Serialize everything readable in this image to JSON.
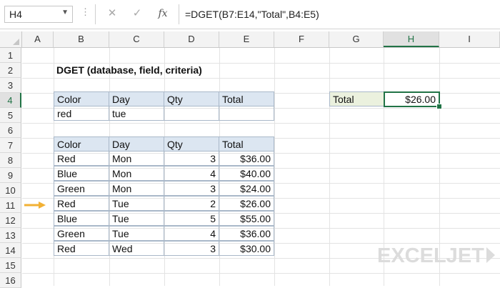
{
  "formula_bar": {
    "name_box": "H4",
    "formula": "=DGET(B7:E14,\"Total\",B4:E5)",
    "icons": [
      "cancel-icon",
      "enter-icon",
      "function-icon"
    ]
  },
  "columns": [
    "A",
    "B",
    "C",
    "D",
    "E",
    "F",
    "G",
    "H",
    "I"
  ],
  "rows": [
    "1",
    "2",
    "3",
    "4",
    "5",
    "6",
    "7",
    "8",
    "9",
    "10",
    "11",
    "12",
    "13",
    "14",
    "15",
    "16"
  ],
  "title": "DGET (database, field, criteria)",
  "criteria": {
    "headers": [
      "Color",
      "Day",
      "Qty",
      "Total"
    ],
    "values": [
      "red",
      "tue",
      "",
      ""
    ]
  },
  "database": {
    "headers": [
      "Color",
      "Day",
      "Qty",
      "Total"
    ],
    "rows": [
      [
        "Red",
        "Mon",
        "3",
        "$36.00"
      ],
      [
        "Blue",
        "Mon",
        "4",
        "$40.00"
      ],
      [
        "Green",
        "Mon",
        "3",
        "$24.00"
      ],
      [
        "Red",
        "Tue",
        "2",
        "$26.00"
      ],
      [
        "Blue",
        "Tue",
        "5",
        "$55.00"
      ],
      [
        "Green",
        "Tue",
        "4",
        "$36.00"
      ],
      [
        "Red",
        "Wed",
        "3",
        "$30.00"
      ]
    ]
  },
  "result": {
    "label": "Total",
    "value": "$26.00"
  },
  "colors": {
    "accent": "#217346",
    "header_fill": "#dce6f1",
    "label_fill": "#ebf1de",
    "arrow": "#f2b134"
  },
  "logo": "EXCELJET"
}
